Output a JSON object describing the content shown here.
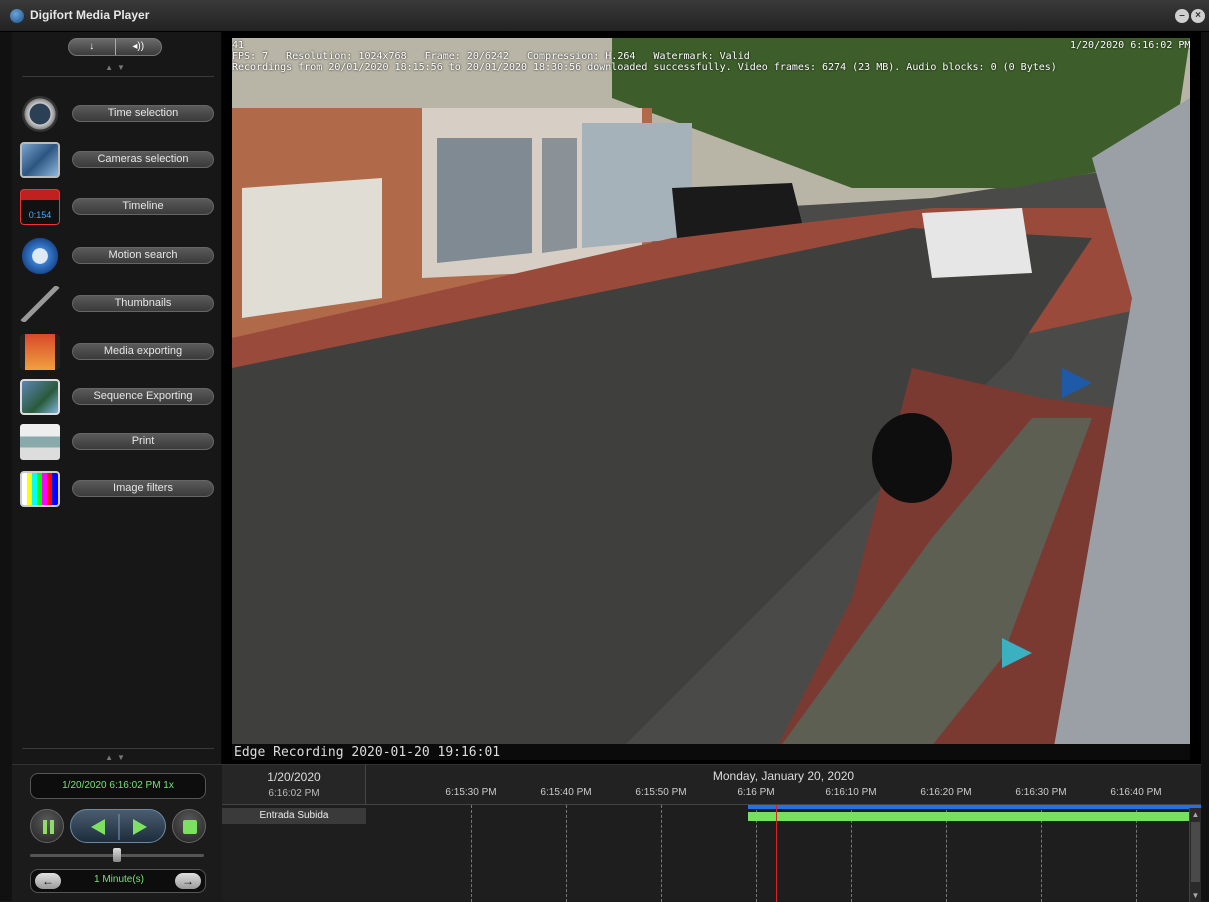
{
  "window": {
    "title": "Digifort Media Player"
  },
  "sidebar": {
    "audio_toggle": {
      "left_icon": "microphone-icon",
      "right_icon": "speaker-icon",
      "left_label": "↓",
      "right_label": "◂))"
    },
    "items": [
      {
        "label": "Time selection",
        "icon": "clock-icon"
      },
      {
        "label": "Cameras selection",
        "icon": "camera-grid-icon"
      },
      {
        "label": "Timeline",
        "icon": "timeline-icon",
        "icon_text": "0:154"
      },
      {
        "label": "Motion search",
        "icon": "motion-search-icon"
      },
      {
        "label": "Thumbnails",
        "icon": "magnifier-icon"
      },
      {
        "label": "Media exporting",
        "icon": "film-export-icon"
      },
      {
        "label": "Sequence Exporting",
        "icon": "sequence-export-icon"
      },
      {
        "label": "Print",
        "icon": "printer-icon"
      },
      {
        "label": "Image filters",
        "icon": "color-bars-icon"
      }
    ]
  },
  "video": {
    "osd_line1": "41",
    "osd_line2": "FPS: 7   Resolution: 1024x768   Frame: 20/6242   Compression: H.264   Watermark: Valid",
    "osd_line3": "Recordings from 20/01/2020 18:15:56 to 20/01/2020 18:30:56 downloaded successfully. Video frames: 6274 (23 MB). Audio blocks: 0 (0 Bytes)",
    "timestamp": "1/20/2020 6:16:02 PM",
    "edge_caption": "Edge Recording 2020-01-20 19:16:01"
  },
  "playback": {
    "current": "1/20/2020 6:16:02 PM 1x",
    "step": "1 Minute(s)",
    "speed_position": 0.5
  },
  "timeline": {
    "date": "1/20/2020",
    "time": "6:16:02 PM",
    "day": "Monday, January 20, 2020",
    "ticks": [
      "6:15:30 PM",
      "6:15:40 PM",
      "6:15:50 PM",
      "6:16 PM",
      "6:16:10 PM",
      "6:16:20 PM",
      "6:16:30 PM",
      "6:16:40 PM"
    ],
    "track_label": "Entrada Subida",
    "colors": {
      "recording": "#77e05e",
      "loaded": "#1e74e0",
      "cursor": "#e02020"
    }
  }
}
